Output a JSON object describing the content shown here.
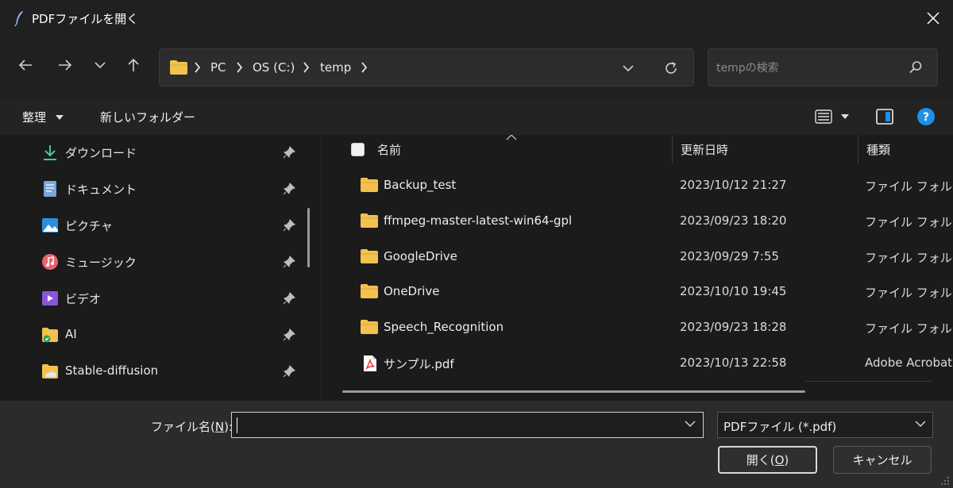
{
  "window": {
    "title": "PDFファイルを開く"
  },
  "nav": {
    "breadcrumbs": [
      "PC",
      "OS (C:)",
      "temp"
    ]
  },
  "search": {
    "placeholder": "tempの検索"
  },
  "toolbar": {
    "organize_label": "整理",
    "new_folder_label": "新しいフォルダー"
  },
  "sidebar": {
    "items": [
      {
        "label": "ダウンロード",
        "icon": "download-icon"
      },
      {
        "label": "ドキュメント",
        "icon": "documents-icon"
      },
      {
        "label": "ピクチャ",
        "icon": "pictures-icon"
      },
      {
        "label": "ミュージック",
        "icon": "music-icon"
      },
      {
        "label": "ビデオ",
        "icon": "videos-icon"
      },
      {
        "label": "AI",
        "icon": "folder-icon"
      },
      {
        "label": "Stable-diffusion",
        "icon": "folder-icon"
      }
    ]
  },
  "columns": {
    "name": "名前",
    "date": "更新日時",
    "type": "種類"
  },
  "files": [
    {
      "name": "Backup_test",
      "date": "2023/10/12 21:27",
      "type": "ファイル フォルダー",
      "icon": "folder-icon"
    },
    {
      "name": "ffmpeg-master-latest-win64-gpl",
      "date": "2023/09/23 18:20",
      "type": "ファイル フォルダー",
      "icon": "folder-icon"
    },
    {
      "name": "GoogleDrive",
      "date": "2023/09/29 7:55",
      "type": "ファイル フォルダー",
      "icon": "folder-icon"
    },
    {
      "name": "OneDrive",
      "date": "2023/10/10 19:45",
      "type": "ファイル フォルダー",
      "icon": "folder-icon"
    },
    {
      "name": "Speech_Recognition",
      "date": "2023/09/23 18:28",
      "type": "ファイル フォルダー",
      "icon": "folder-icon"
    },
    {
      "name": "サンプル.pdf",
      "date": "2023/10/13 22:58",
      "type": "Adobe Acrobat Document",
      "icon": "pdf-icon"
    }
  ],
  "footer": {
    "filename_label_pre": "ファイル名(",
    "filename_label_key": "N",
    "filename_label_post": "):",
    "filename_value": "",
    "filter_value": "PDFファイル (*.pdf)",
    "open_pre": "開く(",
    "open_key": "O",
    "open_post": ")",
    "cancel_label": "キャンセル"
  },
  "colors": {
    "folder": "#f2c14e",
    "accent": "#1e90e8",
    "pdf": "#e5322d"
  }
}
